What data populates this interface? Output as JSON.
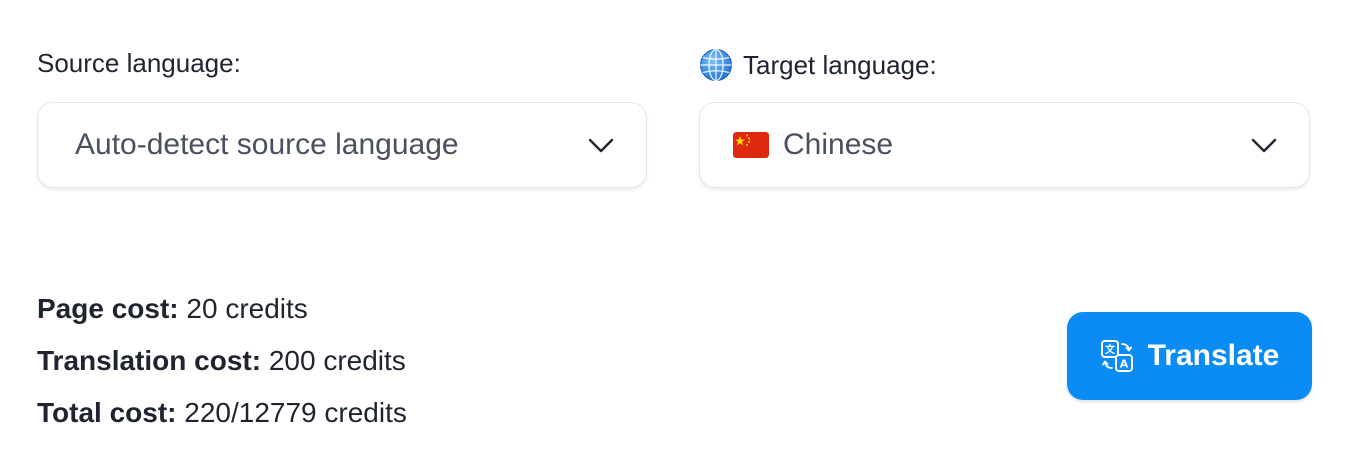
{
  "source": {
    "label": "Source language:",
    "selected_value": "Auto-detect source language",
    "chevron_icon": "chevron-down-icon"
  },
  "target": {
    "label": "Target language:",
    "label_icon": "globe-icon",
    "selected_value": "Chinese",
    "flag_icon": "china-flag-icon",
    "chevron_icon": "chevron-down-icon"
  },
  "costs": {
    "page_label": "Page cost:",
    "page_value": "20 credits",
    "translation_label": "Translation cost:",
    "translation_value": "200 credits",
    "total_label": "Total cost:",
    "total_value": "220/12779 credits"
  },
  "translate_button": {
    "label": "Translate",
    "icon": "translate-icon",
    "color": "#0b8cf5"
  },
  "colors": {
    "text": "#1f2430",
    "muted_text": "#4b5060",
    "border": "#e5e7eb",
    "flag_red": "#de2910",
    "flag_yellow": "#ffde00"
  }
}
